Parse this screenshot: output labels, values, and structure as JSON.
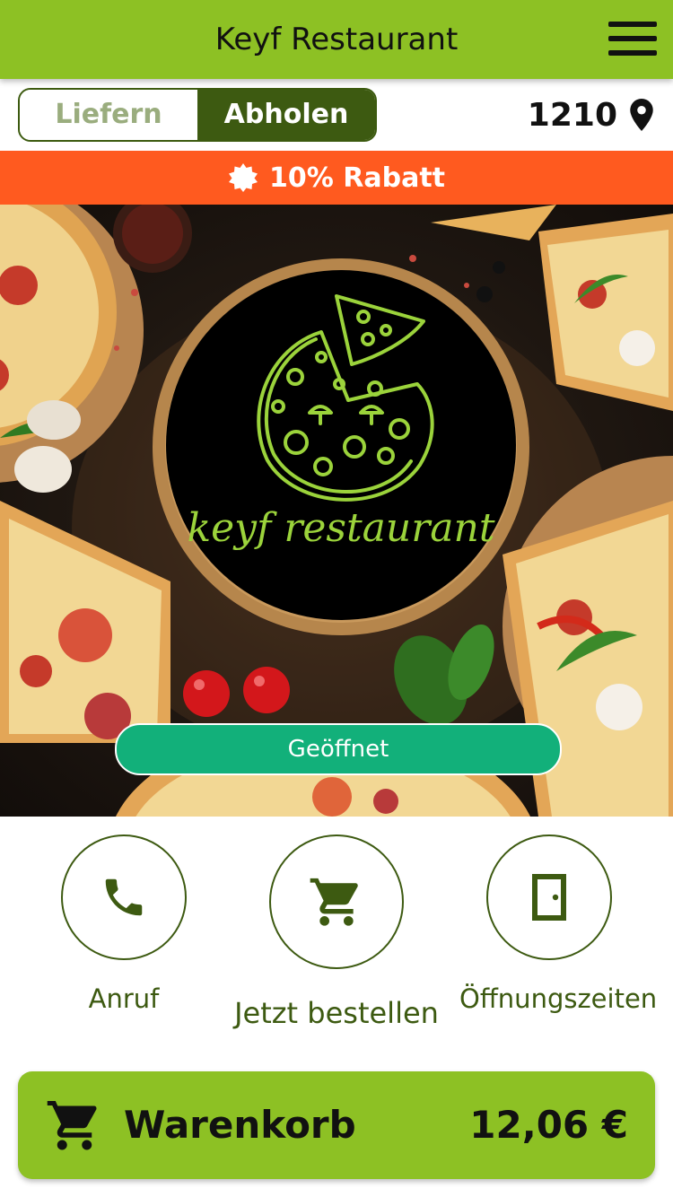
{
  "header": {
    "title": "Keyf Restaurant",
    "menu_icon": "hamburger-menu-icon"
  },
  "order_mode": {
    "options": [
      "Liefern",
      "Abholen"
    ],
    "selected": "Abholen"
  },
  "location": {
    "zip": "1210",
    "icon": "location-pin-icon"
  },
  "discount": {
    "label": "10% Rabatt",
    "icon": "badge-icon"
  },
  "hero": {
    "logo_text": "keyf restaurant",
    "status_label": "Geöffnet"
  },
  "actions": [
    {
      "label": "Anruf",
      "icon": "phone-icon"
    },
    {
      "label": "Jetzt bestellen",
      "icon": "cart-icon"
    },
    {
      "label": "Öffnungszeiten",
      "icon": "door-icon"
    }
  ],
  "cart": {
    "label": "Warenkorb",
    "total": "12,06 €",
    "icon": "cart-icon"
  },
  "colors": {
    "brand_green": "#8dc124",
    "dark_green": "#3d5a11",
    "discount_orange": "#ff5a1f",
    "status_green": "#12b07a",
    "logo_green": "#9bd33b"
  }
}
